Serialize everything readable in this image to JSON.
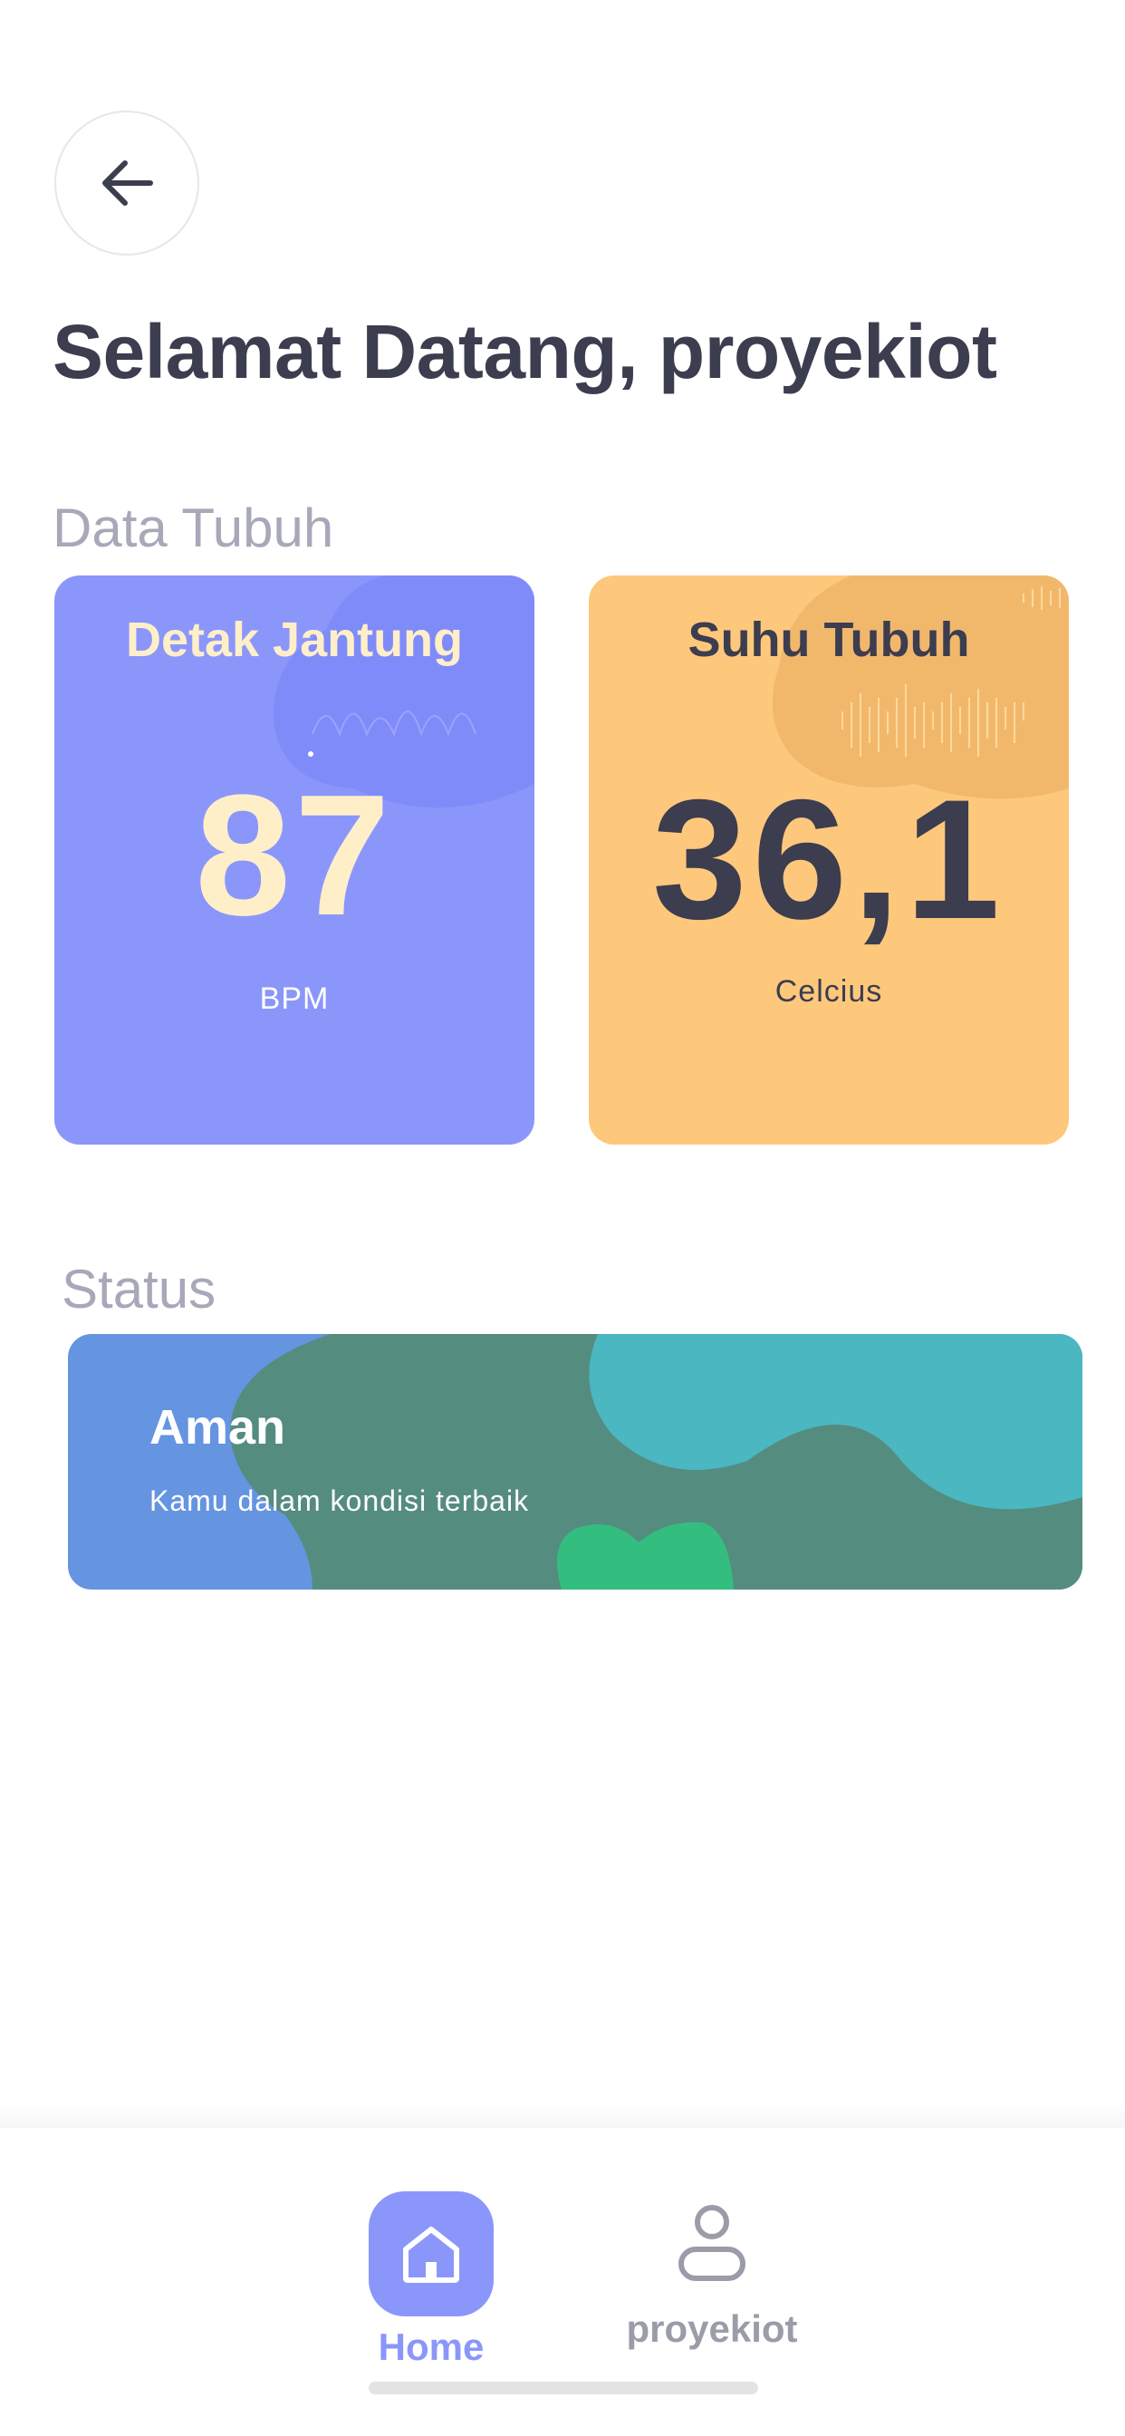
{
  "header": {
    "back_icon": "arrow-left-icon",
    "title": "Selamat Datang, proyekiot"
  },
  "body_data": {
    "section_label": "Data Tubuh",
    "heart_rate": {
      "title": "Detak Jantung",
      "value": "87",
      "unit": "BPM",
      "color": "#8b96fb",
      "text_color": "#ffefc9"
    },
    "temperature": {
      "title": "Suhu Tubuh",
      "value": "36,1",
      "unit": "Celcius",
      "color": "#fdc87c",
      "text_color": "#3c3d4e"
    }
  },
  "status": {
    "section_label": "Status",
    "title": "Aman",
    "subtitle": "Kamu dalam kondisi terbaik",
    "colors": [
      "#6594e1",
      "#558c80",
      "#4ab7c1",
      "#33be80"
    ]
  },
  "bottom_nav": {
    "items": [
      {
        "label": "Home",
        "icon": "home-icon",
        "active": true
      },
      {
        "label": "proyekiot",
        "icon": "user-icon",
        "active": false
      }
    ],
    "active_color": "#8b96fb",
    "inactive_color": "#9a9ca8"
  }
}
